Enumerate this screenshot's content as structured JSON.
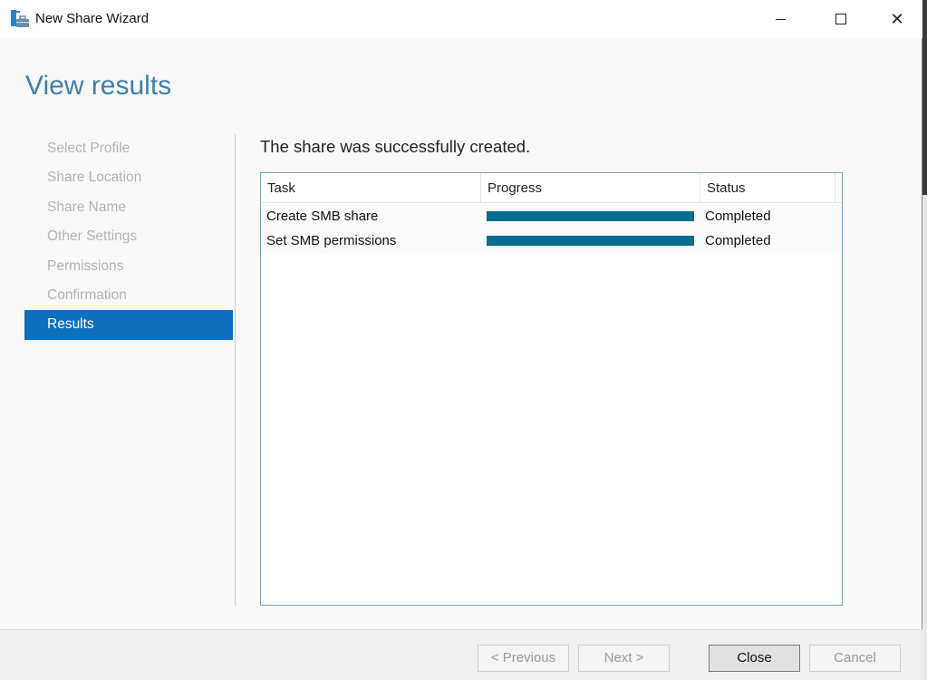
{
  "window": {
    "title": "New Share Wizard",
    "minimize_icon": "minimize-icon",
    "maximize_icon": "maximize-icon",
    "close_icon": "close-icon"
  },
  "page_title": "View results",
  "sidebar": {
    "items": [
      {
        "label": "Select Profile",
        "active": false
      },
      {
        "label": "Share Location",
        "active": false
      },
      {
        "label": "Share Name",
        "active": false
      },
      {
        "label": "Other Settings",
        "active": false
      },
      {
        "label": "Permissions",
        "active": false
      },
      {
        "label": "Confirmation",
        "active": false
      },
      {
        "label": "Results",
        "active": true
      }
    ]
  },
  "main": {
    "message": "The share was successfully created.",
    "table": {
      "columns": [
        "Task",
        "Progress",
        "Status"
      ],
      "rows": [
        {
          "task": "Create SMB share",
          "progress": 100,
          "status": "Completed"
        },
        {
          "task": "Set SMB permissions",
          "progress": 100,
          "status": "Completed"
        }
      ]
    }
  },
  "footer": {
    "previous": "< Previous",
    "next": "Next >",
    "close": "Close",
    "cancel": "Cancel"
  },
  "colors": {
    "accent": "#0c70c0",
    "progress": "#076d8f",
    "title": "#3d80ad"
  }
}
